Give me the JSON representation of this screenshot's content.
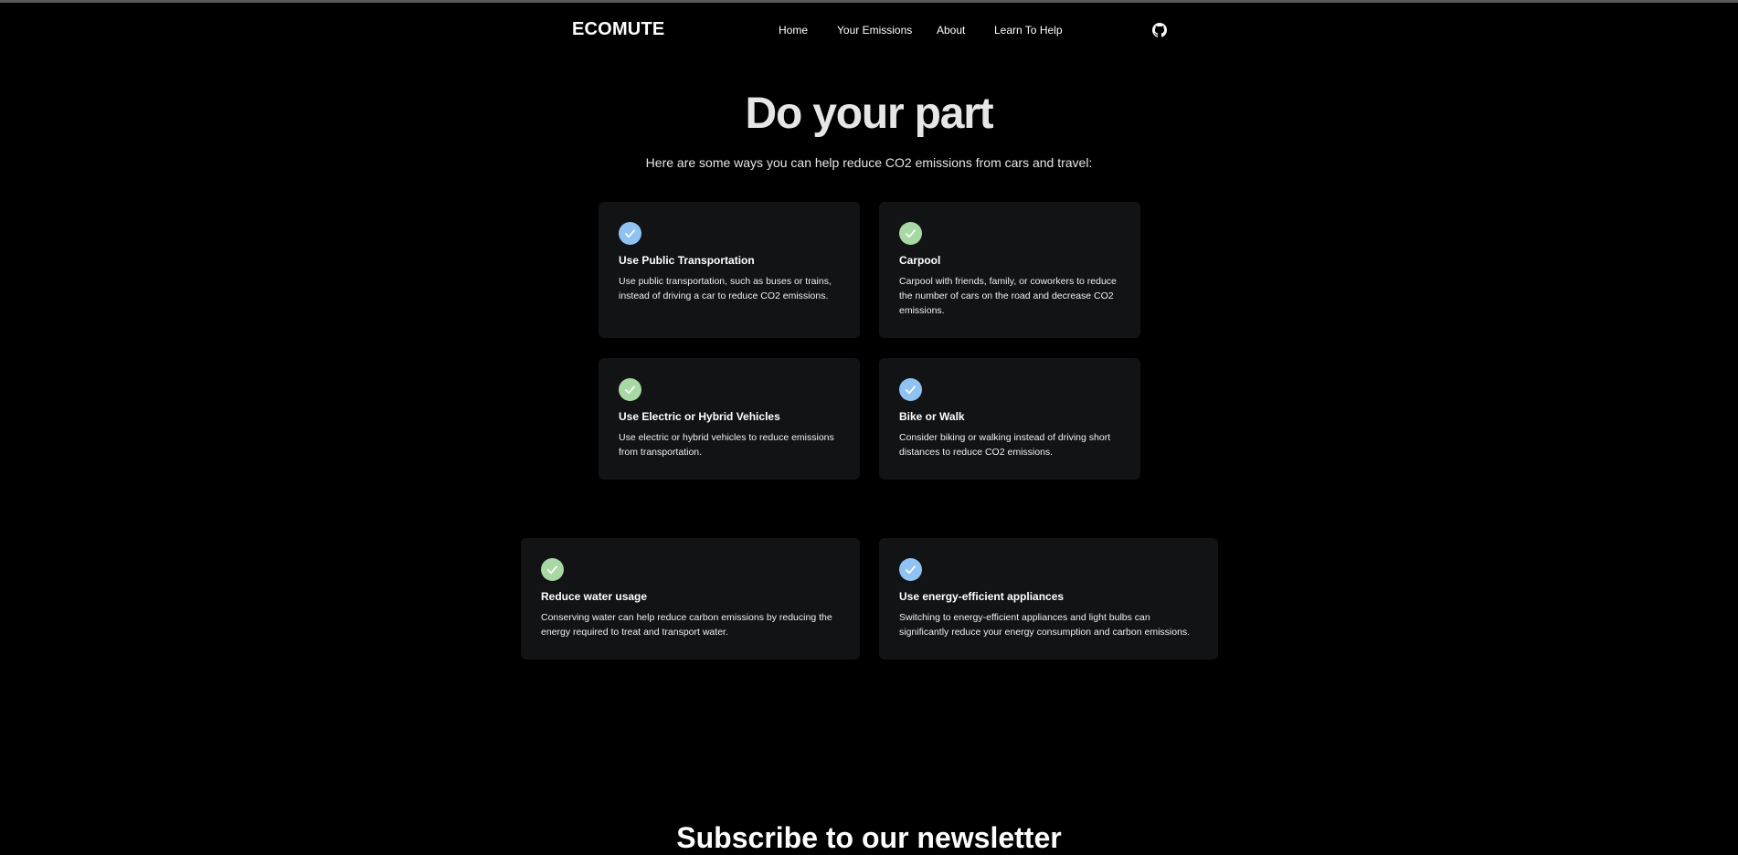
{
  "nav": {
    "brand": "ECOMUTE",
    "links": [
      "Home",
      "Your Emissions",
      "About",
      "Learn To Help"
    ],
    "github_icon": "github-icon"
  },
  "hero": {
    "title": "Do your part",
    "subtitle": "Here are some ways you can help reduce CO2 emissions from cars and travel:"
  },
  "colors": {
    "background": "#000000",
    "card": "#111314",
    "check_blue": "#90c2f2",
    "check_green": "#a8d8a4"
  },
  "cards": [
    {
      "icon": "check-icon",
      "color": "blue",
      "title": "Use Public Transportation",
      "text": "Use public transportation, such as buses or trains, instead of driving a car to reduce CO2 emissions."
    },
    {
      "icon": "check-icon",
      "color": "green",
      "title": "Carpool",
      "text": "Carpool with friends, family, or coworkers to reduce the number of cars on the road and decrease CO2 emissions."
    },
    {
      "icon": "check-icon",
      "color": "green",
      "title": "Use Electric or Hybrid Vehicles",
      "text": "Use electric or hybrid vehicles to reduce emissions from transportation."
    },
    {
      "icon": "check-icon",
      "color": "blue",
      "title": "Bike or Walk",
      "text": "Consider biking or walking instead of driving short distances to reduce CO2 emissions."
    },
    {
      "icon": "check-icon",
      "color": "green",
      "title": "Reduce water usage",
      "text": "Conserving water can help reduce carbon emissions by reducing the energy required to treat and transport water."
    },
    {
      "icon": "check-icon",
      "color": "blue",
      "title": "Use energy-efficient appliances",
      "text": "Switching to energy-efficient appliances and light bulbs can significantly reduce your energy consumption and carbon emissions."
    }
  ],
  "newsletter": {
    "title": "Subscribe to our newsletter"
  }
}
